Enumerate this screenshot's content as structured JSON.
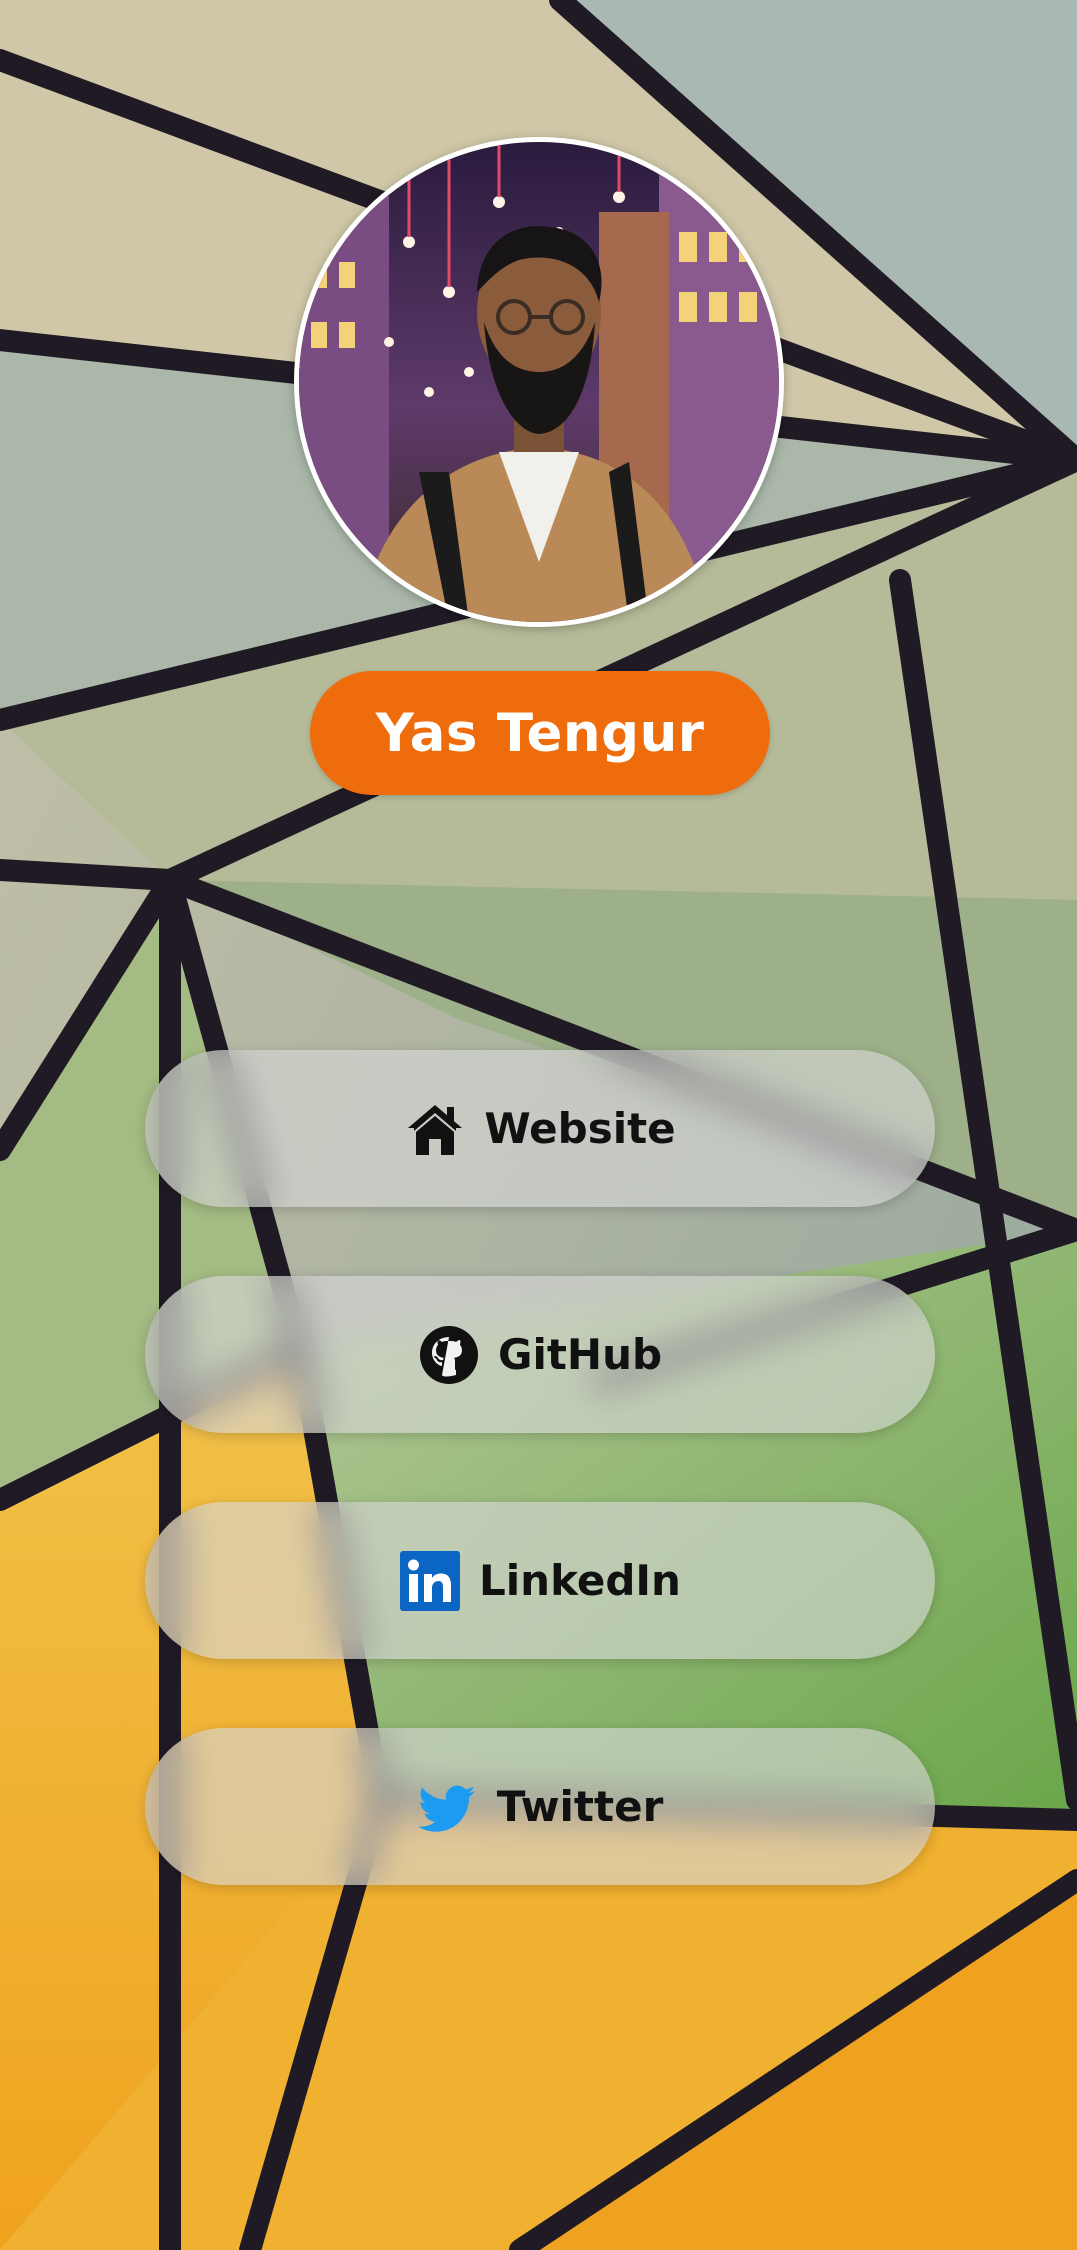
{
  "profile": {
    "name": "Yas Tengur"
  },
  "links": [
    {
      "label": "Website",
      "icon": "home-icon"
    },
    {
      "label": "GitHub",
      "icon": "github-icon"
    },
    {
      "label": "LinkedIn",
      "icon": "linkedin-icon"
    },
    {
      "label": "Twitter",
      "icon": "twitter-icon"
    }
  ],
  "colors": {
    "name_badge": "#ef6c0c",
    "linkedin": "#0a66c2",
    "twitter": "#1d9bf0",
    "button_text": "#111111"
  }
}
